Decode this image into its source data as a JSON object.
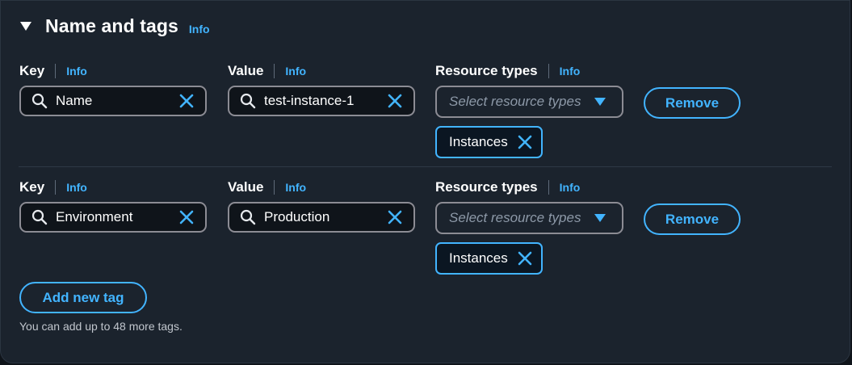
{
  "section": {
    "title": "Name and tags",
    "info_label": "Info"
  },
  "labels": {
    "key": "Key",
    "value": "Value",
    "resource_types": "Resource types",
    "info": "Info"
  },
  "tags": [
    {
      "key": "Name",
      "value": "test-instance-1",
      "resource_types_placeholder": "Select resource types",
      "selected_resource_types": [
        "Instances"
      ],
      "remove_label": "Remove"
    },
    {
      "key": "Environment",
      "value": "Production",
      "resource_types_placeholder": "Select resource types",
      "selected_resource_types": [
        "Instances"
      ],
      "remove_label": "Remove"
    }
  ],
  "add_button_label": "Add new tag",
  "hint_text": "You can add up to 48 more tags.",
  "colors": {
    "accent": "#42b4ff",
    "panel_bg": "#1b232d",
    "input_bg": "#0f141a",
    "border": "#8c8c94"
  },
  "icons": [
    "caret-down-icon",
    "search-icon",
    "clear-icon",
    "dropdown-arrow-icon",
    "token-remove-icon"
  ]
}
